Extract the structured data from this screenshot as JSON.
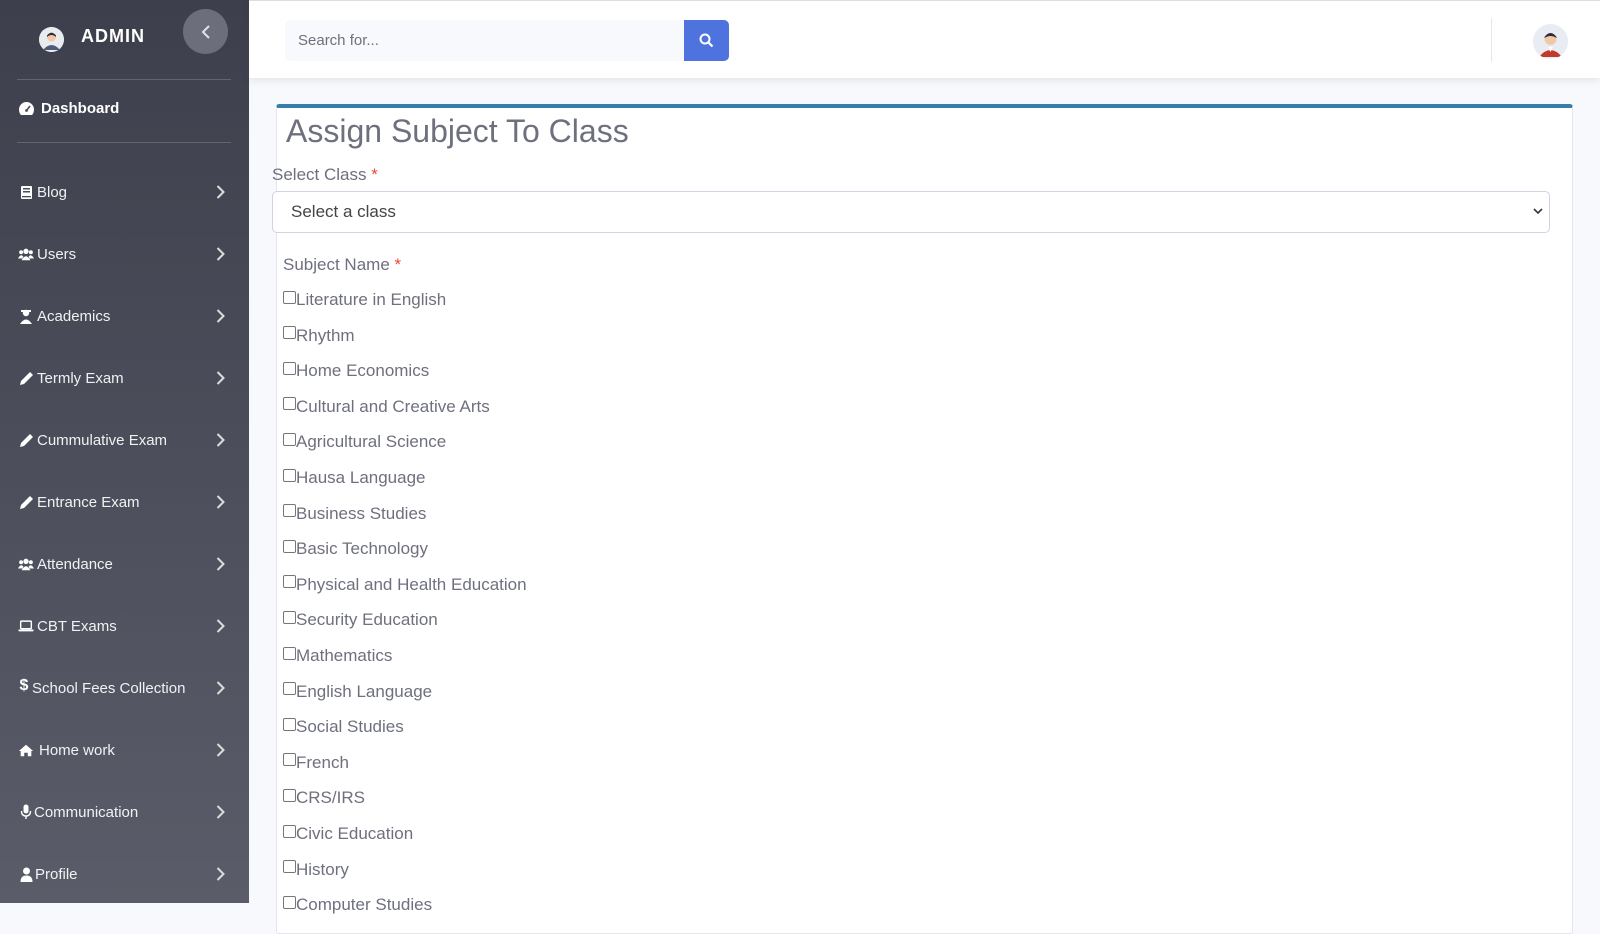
{
  "sidebar": {
    "brand": "ADMIN",
    "dashboard": "Dashboard",
    "items": [
      {
        "label": "Blog",
        "icon": "book-icon"
      },
      {
        "label": "Users",
        "icon": "users-icon"
      },
      {
        "label": "Academics",
        "icon": "teacher-icon"
      },
      {
        "label": "Termly Exam",
        "icon": "pencil-icon"
      },
      {
        "label": "Cummulative Exam",
        "icon": "pencil-icon"
      },
      {
        "label": "Entrance Exam",
        "icon": "pencil-icon"
      },
      {
        "label": "Attendance",
        "icon": "users-icon"
      },
      {
        "label": "CBT Exams",
        "icon": "laptop-icon"
      },
      {
        "label": "School Fees Collection",
        "icon": "dollar-icon"
      },
      {
        "label": "Home work",
        "icon": "home-icon"
      },
      {
        "label": "Communication",
        "icon": "microphone-icon"
      },
      {
        "label": "Profile",
        "icon": "user-icon"
      }
    ]
  },
  "topbar": {
    "search_placeholder": "Search for..."
  },
  "form": {
    "title": "Assign Subject To Class",
    "class_label": "Select Class",
    "required_mark": "*",
    "class_select_value": "Select a class",
    "subject_label": "Subject Name",
    "subjects": [
      "Literature in English",
      "Rhythm",
      "Home Economics",
      "Cultural and Creative Arts",
      "Agricultural Science",
      "Hausa Language",
      "Business Studies",
      "Basic Technology",
      "Physical and Health Education",
      "Security Education",
      "Mathematics",
      "English Language",
      "Social Studies",
      "French",
      "CRS/IRS",
      "Civic Education",
      "History",
      "Computer Studies"
    ]
  },
  "colors": {
    "sidebar_top": "#3d3f4c",
    "sidebar_bottom": "#5a5c69",
    "primary": "#4e73df",
    "card_border_top": "#367fa9",
    "required": "#e74a3b"
  }
}
